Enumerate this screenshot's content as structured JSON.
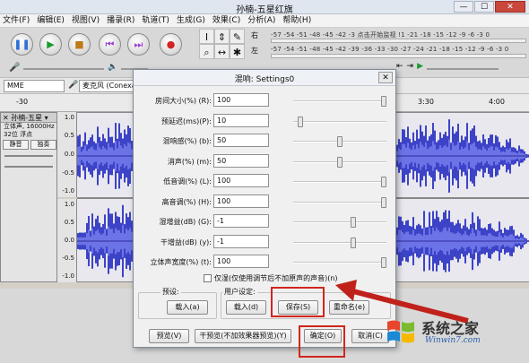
{
  "window": {
    "title": "孙楠-五星红旗",
    "controls": [
      "—",
      "☐",
      "✕"
    ]
  },
  "menu": [
    "文件(F)",
    "编辑(E)",
    "视图(V)",
    "播录(R)",
    "轨道(T)",
    "生成(G)",
    "效果(C)",
    "分析(A)",
    "帮助(H)"
  ],
  "transport": {
    "buttons": [
      "pause",
      "play",
      "stop",
      "skip-start",
      "skip-end",
      "record"
    ],
    "colors": {
      "pause": "#2c6fd6",
      "play": "#1e9a2e",
      "stop": "#c07a18",
      "skip": "#9b3bd0",
      "record": "#d32222"
    }
  },
  "meter": {
    "left_label": "左",
    "right_label": "右",
    "scale_top": "-57 -54 -51 -48 -45 -42 -3 点击开始监视 !1 -21 -18 -15 -12 -9 -6 -3 0",
    "scale_bottom": "-57 -54 -51 -48 -45 -42 -39 -36 -33 -30 -27 -24 -21 -18 -15 -12 -9 -6 -3 0"
  },
  "devices": {
    "host": "MME",
    "input": "麦克风 (Conexan"
  },
  "ruler": {
    "left": "-30",
    "labels": [
      "3:30",
      "4:00"
    ]
  },
  "track": {
    "name": "孙楠-五星",
    "info_lines": [
      "立体声, 16000Hz",
      "32位 浮点"
    ],
    "mute": "静音",
    "solo": "独奏",
    "scale_top": [
      "1.0",
      "0.5",
      "0.0",
      "-0.5",
      "-1.0"
    ],
    "scale_bottom": [
      "1.0",
      "0.5",
      "0.0",
      "-0.5",
      "-1.0"
    ]
  },
  "dialog": {
    "title": "混响: Settings0",
    "close": "✕",
    "params": [
      {
        "label": "房间大小(%) (R):",
        "value": "100",
        "level": 1.0
      },
      {
        "label": "预延迟(ms)(P):",
        "value": "10",
        "level": 0.05
      },
      {
        "label": "混响感(%) (b):",
        "value": "50",
        "level": 0.5
      },
      {
        "label": "消声(%) (m):",
        "value": "50",
        "level": 0.5
      },
      {
        "label": "低音调(%) (L):",
        "value": "100",
        "level": 1.0
      },
      {
        "label": "高音调(%) (H):",
        "value": "100",
        "level": 1.0
      },
      {
        "label": "湿增益(dB) (G):",
        "value": "-1",
        "level": 0.65
      },
      {
        "label": "干增益(dB) (y):",
        "value": "-1",
        "level": 0.65
      },
      {
        "label": "立体声宽度(%) (t):",
        "value": "100",
        "level": 1.0
      }
    ],
    "wet_only": "仅湿(仅使用调节后不加原声的声音)(n)",
    "preset_group": "预设:",
    "user_group": "用户设定:",
    "load_preset": "载入(a)",
    "load_user": "载入(d)",
    "save": "保存(S)",
    "rename": "重命名(e)",
    "preview": "预览(V)",
    "dry_preview": "干预览(不加效果器预览)(Y)",
    "ok": "确定(O)",
    "cancel": "取消(C)"
  },
  "watermark": {
    "text": "系统之家",
    "url": "Winwin7.com"
  }
}
